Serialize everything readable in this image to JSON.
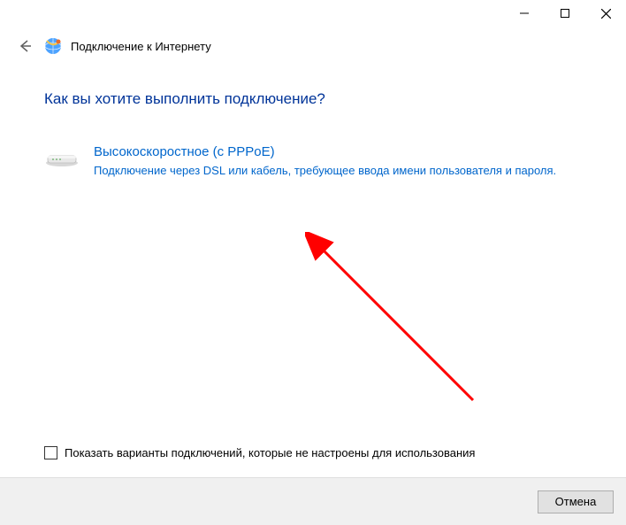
{
  "titlebar": {
    "minimize": "minimize",
    "maximize": "maximize",
    "close": "close"
  },
  "header": {
    "title": "Подключение к Интернету"
  },
  "main": {
    "heading": "Как вы хотите выполнить подключение?",
    "option": {
      "title": "Высокоскоростное (с PPPoE)",
      "description": "Подключение через DSL или кабель, требующее ввода имени пользователя и пароля."
    },
    "checkbox_label": "Показать варианты подключений, которые не настроены для использования"
  },
  "footer": {
    "cancel_label": "Отмена"
  }
}
